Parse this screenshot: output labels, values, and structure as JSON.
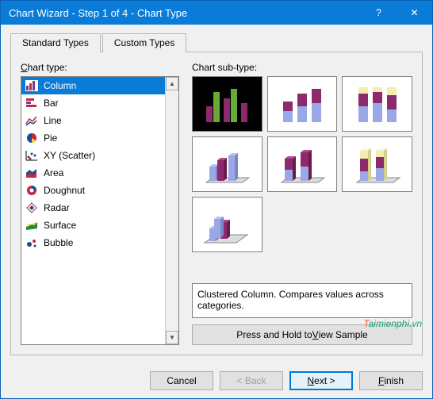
{
  "window": {
    "title": "Chart Wizard - Step 1 of 4 - Chart Type",
    "help": "?",
    "close": "✕"
  },
  "tabs": {
    "standard": "Standard Types",
    "custom": "Custom Types"
  },
  "left": {
    "label_pre": "C",
    "label_post": "hart type:"
  },
  "chart_types": [
    "Column",
    "Bar",
    "Line",
    "Pie",
    "XY (Scatter)",
    "Area",
    "Doughnut",
    "Radar",
    "Surface",
    "Bubble"
  ],
  "right": {
    "label": "Chart sub-type:"
  },
  "description": "Clustered Column. Compares values across categories.",
  "view_sample_pre": "Press and Hold to ",
  "view_sample_u": "V",
  "view_sample_post": "iew Sample",
  "buttons": {
    "cancel": "Cancel",
    "back": "< Back",
    "next_pre": "N",
    "next_post": "ext >",
    "finish_pre": "F",
    "finish_post": "inish"
  },
  "watermark": "aimienphi.vn"
}
